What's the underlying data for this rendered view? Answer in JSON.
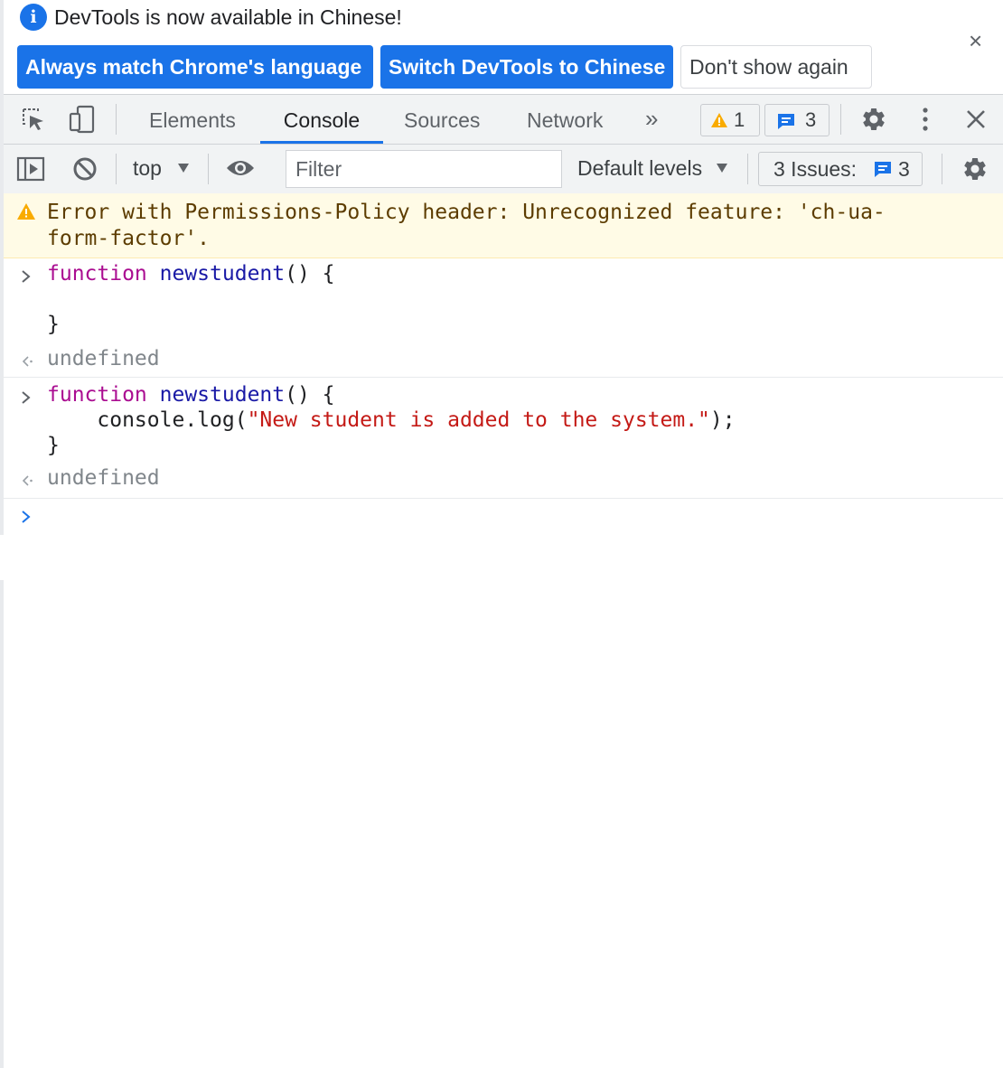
{
  "infobar": {
    "message": "DevTools is now available in Chinese!",
    "btn_match": "Always match Chrome's language",
    "btn_switch": "Switch DevTools to Chinese",
    "btn_dismiss": "Don't show again",
    "close": "×"
  },
  "tabs": [
    "Elements",
    "Console",
    "Sources",
    "Network"
  ],
  "more_tabs": "»",
  "warnings_count": "1",
  "messages_count": "3",
  "console_toolbar": {
    "context": "top",
    "filter_placeholder": "Filter",
    "levels": "Default levels",
    "issues_label": "3 Issues:",
    "issues_count": "3"
  },
  "messages": {
    "warning_line1": "Error with Permissions-Policy header: Unrecognized feature: 'ch-ua-",
    "warning_line2": "form-factor'.",
    "entry1": {
      "kw": "function",
      "name": "newstudent",
      "tail": "() {",
      "close": "}",
      "result": "undefined"
    },
    "entry2": {
      "kw": "function",
      "name": "newstudent",
      "tail": "() {",
      "body_pre": "    console.log(",
      "body_str": "\"New student is added to the system.\"",
      "body_post": ");",
      "close": "}",
      "result": "undefined"
    }
  },
  "colors": {
    "accent": "#1a73e8",
    "warning_bg": "#fffbe6",
    "keyword": "#aa0d91",
    "string": "#c41a16"
  }
}
